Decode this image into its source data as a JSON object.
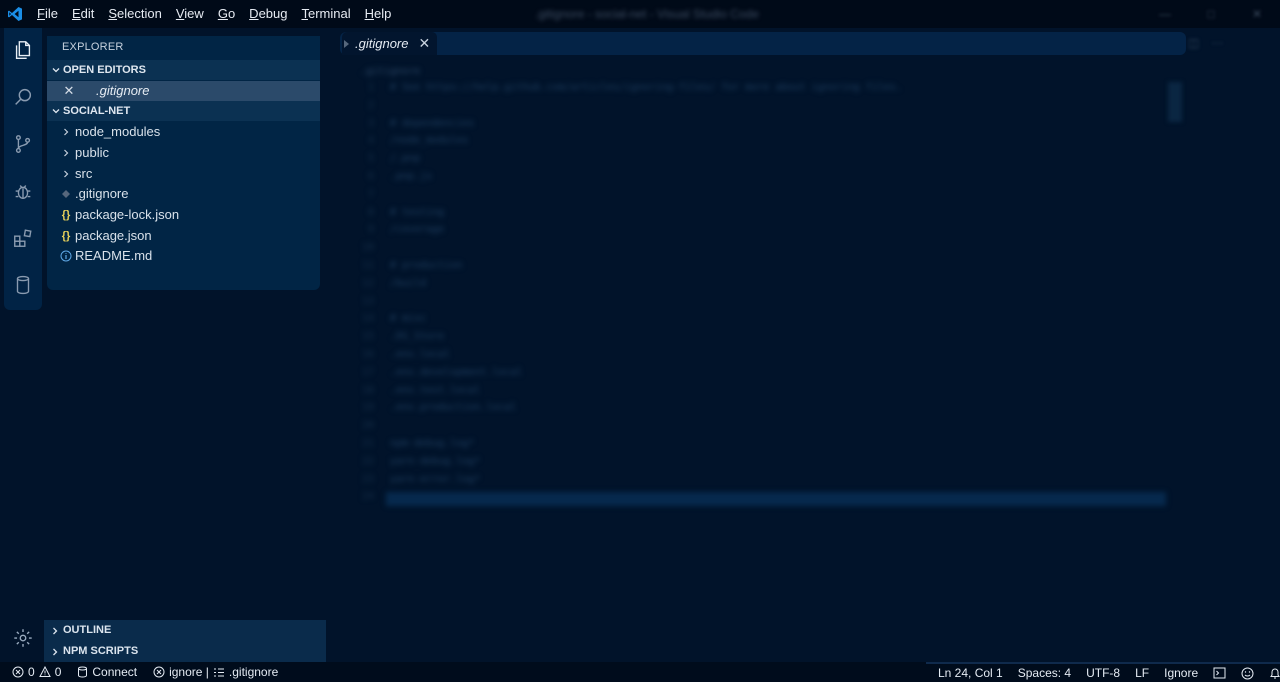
{
  "titlebar": {
    "menu": [
      "File",
      "Edit",
      "Selection",
      "View",
      "Go",
      "Debug",
      "Terminal",
      "Help"
    ],
    "window_title": ".gitignore - social-net - Visual Studio Code"
  },
  "sidebar": {
    "title": "EXPLORER",
    "open_editors": {
      "label": "OPEN EDITORS",
      "items": [
        ".gitignore"
      ]
    },
    "project": {
      "label": "SOCIAL-NET",
      "folders": [
        "node_modules",
        "public",
        "src"
      ],
      "files": [
        ".gitignore",
        "package-lock.json",
        "package.json",
        "README.md"
      ]
    },
    "bottom_sections": [
      "OUTLINE",
      "NPM SCRIPTS"
    ]
  },
  "editor": {
    "tab": ".gitignore",
    "lines": [
      "# See https://help.github.com/articles/ignoring-files/ for more about ignoring files.",
      "",
      "# dependencies",
      "/node_modules",
      "/.pnp",
      ".pnp.js",
      "",
      "# testing",
      "/coverage",
      "",
      "# production",
      "/build",
      "",
      "# misc",
      ".DS_Store",
      ".env.local",
      ".env.development.local",
      ".env.test.local",
      ".env.production.local",
      "",
      "npm-debug.log*",
      "yarn-debug.log*",
      "yarn-error.log*",
      ""
    ]
  },
  "statusbar": {
    "errors": "0",
    "warnings": "0",
    "connect": "Connect",
    "language_info": "ignore |",
    "file": ".gitignore",
    "position": "Ln 24, Col 1",
    "spaces": "Spaces: 4",
    "encoding": "UTF-8",
    "eol": "LF",
    "language": "Ignore"
  },
  "colors": {
    "background": "#01132a",
    "sidebar": "#012545",
    "accent": "#1a7fd4"
  }
}
